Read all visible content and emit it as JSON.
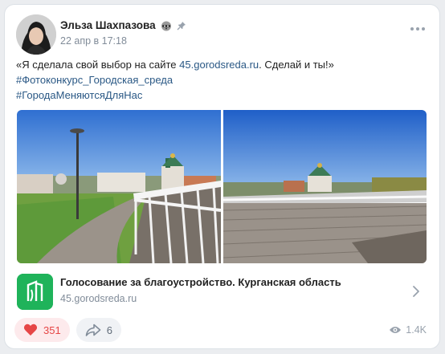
{
  "post": {
    "author": "Эльза Шахпазова",
    "author_badge_icon": "raccoon-emoji-icon",
    "pinned_icon": "pin-icon",
    "date": "22 апр в 17:18",
    "text_before_link": "«Я сделала свой выбор на сайте ",
    "text_link": "45.gorodsreda.ru",
    "text_after_link": ". Сделай и ты!»",
    "hashtag1": "#Фотоконкурс_Городская_среда",
    "hashtag2": "#ГородаМеняютсяДляНас"
  },
  "attachment": {
    "title": "Голосование за благоустройство. Курганская область",
    "domain": "45.gorodsreda.ru"
  },
  "actions": {
    "likes": "351",
    "shares": "6",
    "views": "1.4K"
  },
  "colors": {
    "accent_link": "#2a5885",
    "like_red": "#e64646",
    "logo_green": "#1fb35a"
  }
}
